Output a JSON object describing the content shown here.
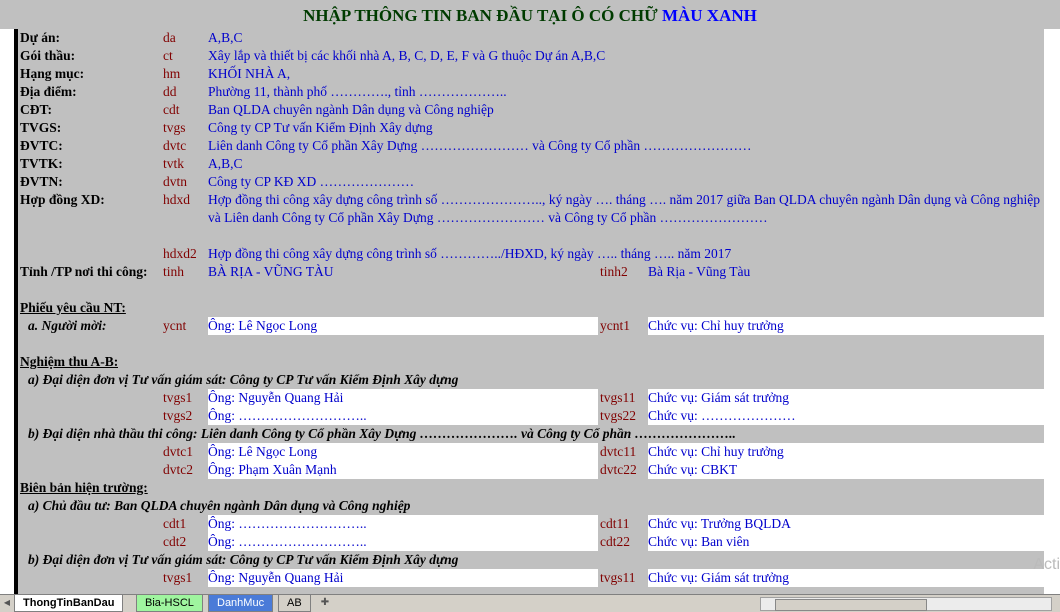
{
  "title": {
    "part1": "NHẬP THÔNG TIN BAN ĐẦU TẠI Ô CÓ CHỮ",
    "part2": "MÀU XANH"
  },
  "general": [
    {
      "label": "Dự án:",
      "code": "da",
      "value": "A,B,C"
    },
    {
      "label": "Gói thầu:",
      "code": "ct",
      "value": "Xây lắp và thiết bị các khối nhà A, B, C, D, E, F và G thuộc Dự án A,B,C"
    },
    {
      "label": "Hạng mục:",
      "code": "hm",
      "value": "KHỐI NHÀ A,"
    },
    {
      "label": "Địa điểm:",
      "code": "dd",
      "value": "Phường 11, thành phố …………., tỉnh ……………….."
    },
    {
      "label": "CĐT:",
      "code": "cdt",
      "value": "Ban QLDA chuyên ngành Dân dụng và Công nghiệp"
    },
    {
      "label": "TVGS:",
      "code": "tvgs",
      "value": "Công ty CP Tư vấn Kiểm Định Xây dựng"
    },
    {
      "label": "ĐVTC:",
      "code": "dvtc",
      "value": "Liên danh Công ty Cổ phần Xây Dựng …………………… và Công ty Cổ phần ……………………"
    },
    {
      "label": "TVTK:",
      "code": "tvtk",
      "value": "A,B,C"
    },
    {
      "label": "ĐVTN:",
      "code": "dvtn",
      "value": "Công ty CP KĐ XD …………………"
    }
  ],
  "contract": {
    "label": "Hợp đồng XD:",
    "code": "hdxd",
    "value": "Hợp đồng thi công xây dựng công trình số ………………….., ký ngày …. tháng …. năm 2017 giữa Ban QLDA chuyên ngành Dân dụng và Công nghiệp và Liên danh Công ty Cổ phần Xây Dựng …………………… và Công ty Cổ phần ……………………",
    "code2": "hdxd2",
    "value2": "Hợp đồng thi công xây dựng công trình số …………../HĐXD, ký ngày ….. tháng ….. năm 2017"
  },
  "province": {
    "label": "Tỉnh /TP nơi thi công:",
    "code": "tinh",
    "value": "BÀ RỊA - VŨNG TÀU",
    "code2": "tinh2",
    "value2": "Bà Rịa - Vũng Tàu"
  },
  "request": {
    "heading": "Phiếu yêu cầu NT:",
    "sublabel": "a. Người mời:",
    "code": "ycnt",
    "value": "Ông: Lê Ngọc Long",
    "code2": "ycnt1",
    "value2": "Chức vụ: Chỉ huy trưởng"
  },
  "acceptance": {
    "heading": "Nghiệm thu A-B:",
    "sub_a": "a) Đại diện đơn vị Tư vấn giám sát: Công ty CP Tư vấn Kiểm Định Xây dựng",
    "rows_a": [
      {
        "code": "tvgs1",
        "value": "Ông: Nguyễn Quang Hải",
        "code2": "tvgs11",
        "value2": "Chức vụ: Giám sát trưởng"
      },
      {
        "code": "tvgs2",
        "value": "Ông: ………………………..",
        "code2": "tvgs22",
        "value2": "Chức vụ: …………………"
      }
    ],
    "sub_b": "b) Đại diện nhà thầu thi công: Liên danh Công ty Cổ phần Xây Dựng …………………. và Công ty Cổ phần …………………..",
    "rows_b": [
      {
        "code": "dvtc1",
        "value": "Ông: Lê Ngọc Long",
        "code2": "dvtc11",
        "value2": "Chức vụ: Chỉ huy trưởng"
      },
      {
        "code": "dvtc2",
        "value": "Ông: Phạm Xuân Mạnh",
        "code2": "dvtc22",
        "value2": "Chức vụ: CBKT"
      }
    ]
  },
  "site": {
    "heading": "Biên bản hiện trường:",
    "sub_a": "a) Chủ đầu tư: Ban QLDA chuyên ngành Dân dụng và Công nghiệp",
    "rows_a": [
      {
        "code": "cdt1",
        "value": "Ông: ………………………..",
        "code2": "cdt11",
        "value2": "Chức vụ: Trưởng BQLDA"
      },
      {
        "code": "cdt2",
        "value": "Ông: ………………………..",
        "code2": "cdt22",
        "value2": "Chức vụ: Ban viên"
      }
    ],
    "sub_b": "b) Đại diện đơn vị Tư vấn giám sát: Công ty CP Tư vấn Kiểm Định Xây dựng",
    "rows_b": [
      {
        "code": "tvgs1",
        "value": "Ông: Nguyễn Quang Hải",
        "code2": "tvgs11",
        "value2": "Chức vụ: Giám sát trưởng"
      }
    ]
  },
  "tabs": [
    "ThongTinBanDau",
    "Bia-HSCL",
    "DanhMuc",
    "AB"
  ],
  "watermark": "Acti"
}
